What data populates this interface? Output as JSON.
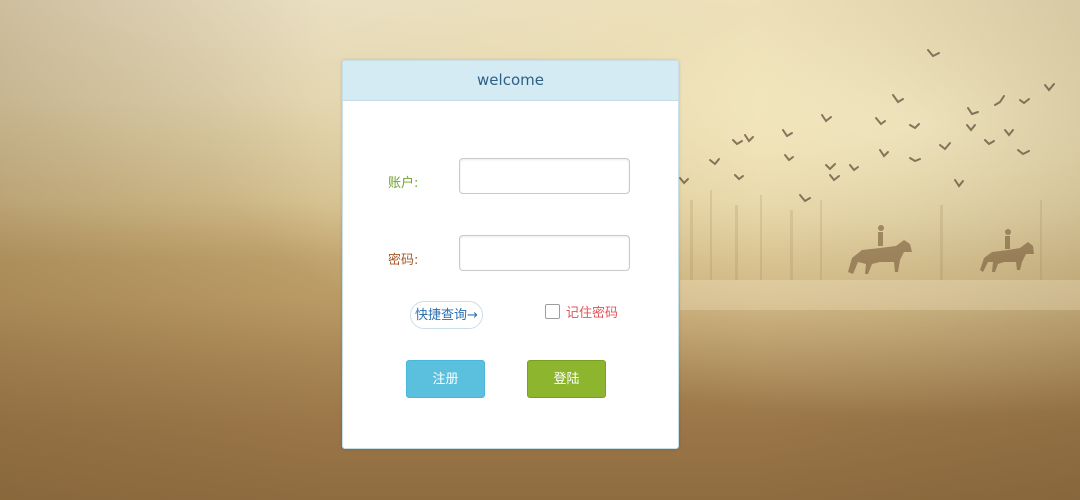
{
  "panel": {
    "title": "welcome"
  },
  "form": {
    "account_label": "账户:",
    "account_value": "",
    "password_label": "密码:",
    "password_value": "",
    "quick_query_label": "快捷查询→",
    "remember_label": "记住密码",
    "remember_checked": false,
    "register_label": "注册",
    "login_label": "登陆"
  },
  "colors": {
    "header_bg": "#d5ebf4",
    "title_text": "#2d5f86",
    "account_label": "#6ea42a",
    "password_label": "#a55a2a",
    "remember_label": "#e0545b",
    "register_button": "#5bc0de",
    "login_button": "#8db52e"
  }
}
